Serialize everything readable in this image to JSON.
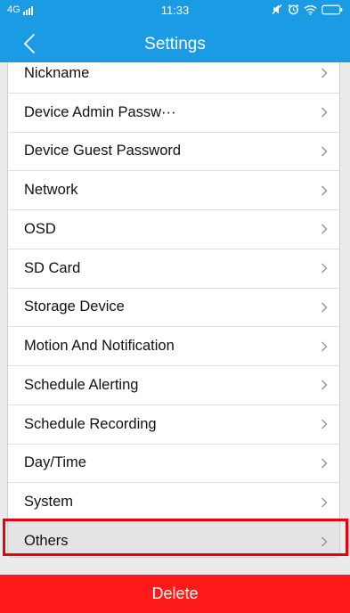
{
  "status_bar": {
    "network": "4G",
    "time": "11:33"
  },
  "header": {
    "title": "Settings",
    "back_icon": "chevron-left-icon"
  },
  "settings_items": [
    {
      "label": "Nickname"
    },
    {
      "label": "Device Admin Passw···"
    },
    {
      "label": "Device Guest Password"
    },
    {
      "label": "Network"
    },
    {
      "label": "OSD"
    },
    {
      "label": "SD Card"
    },
    {
      "label": "Storage Device"
    },
    {
      "label": "Motion And Notification"
    },
    {
      "label": "Schedule Alerting"
    },
    {
      "label": "Schedule Recording"
    },
    {
      "label": "Day/Time"
    },
    {
      "label": "System"
    },
    {
      "label": "Others"
    }
  ],
  "highlighted_item": "Others",
  "footer": {
    "delete_label": "Delete"
  },
  "colors": {
    "header_blue": "#1a9be3",
    "delete_red": "#ff1a1a",
    "highlight_red": "#e8000d",
    "background": "#ebebeb"
  }
}
